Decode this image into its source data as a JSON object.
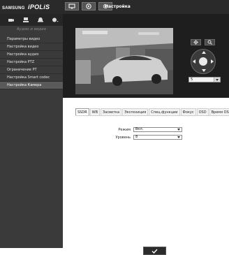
{
  "header": {
    "brand": "SAMSUNG",
    "product": "iPOLiS",
    "breadcrumb": "Настройка",
    "buttons": [
      {
        "icon": "monitor-icon"
      },
      {
        "icon": "playback-icon"
      },
      {
        "icon": "gear-icon"
      }
    ]
  },
  "sidebar": {
    "icons": [
      "camera-icon",
      "network-icon",
      "alarm-icon",
      "system-icon"
    ],
    "section_title": "Аудио и видео",
    "items": [
      {
        "label": "Параметры видео",
        "active": false
      },
      {
        "label": "Настройка видео",
        "active": false
      },
      {
        "label": "Настройка аудио",
        "active": false
      },
      {
        "label": "Настройка PTZ",
        "active": false
      },
      {
        "label": "Ограничение PT",
        "active": false
      },
      {
        "label": "Настройка Smart codec",
        "active": false
      },
      {
        "label": "Настройка Камера",
        "active": true
      }
    ]
  },
  "ptz": {
    "preset_value": "5"
  },
  "tabs": [
    {
      "label": "SSDR",
      "active": true
    },
    {
      "label": "WB",
      "active": false
    },
    {
      "label": "Засветка",
      "active": false
    },
    {
      "label": "Экспозиция",
      "active": false
    },
    {
      "label": "Спец.функции",
      "active": false
    },
    {
      "label": "Фокус",
      "active": false
    },
    {
      "label": "OSD",
      "active": false
    },
    {
      "label": "Время OSD",
      "active": false
    }
  ],
  "form": {
    "mode_label": "Режим",
    "mode_value": "Вкл.",
    "level_label": "Уровень",
    "level_value": "8"
  },
  "colors": {
    "topbar": "#2a2a2a",
    "sidebar": "#3a3a3a",
    "active_item": "#5a5a5a",
    "video_bg": "#1e1e1e"
  }
}
